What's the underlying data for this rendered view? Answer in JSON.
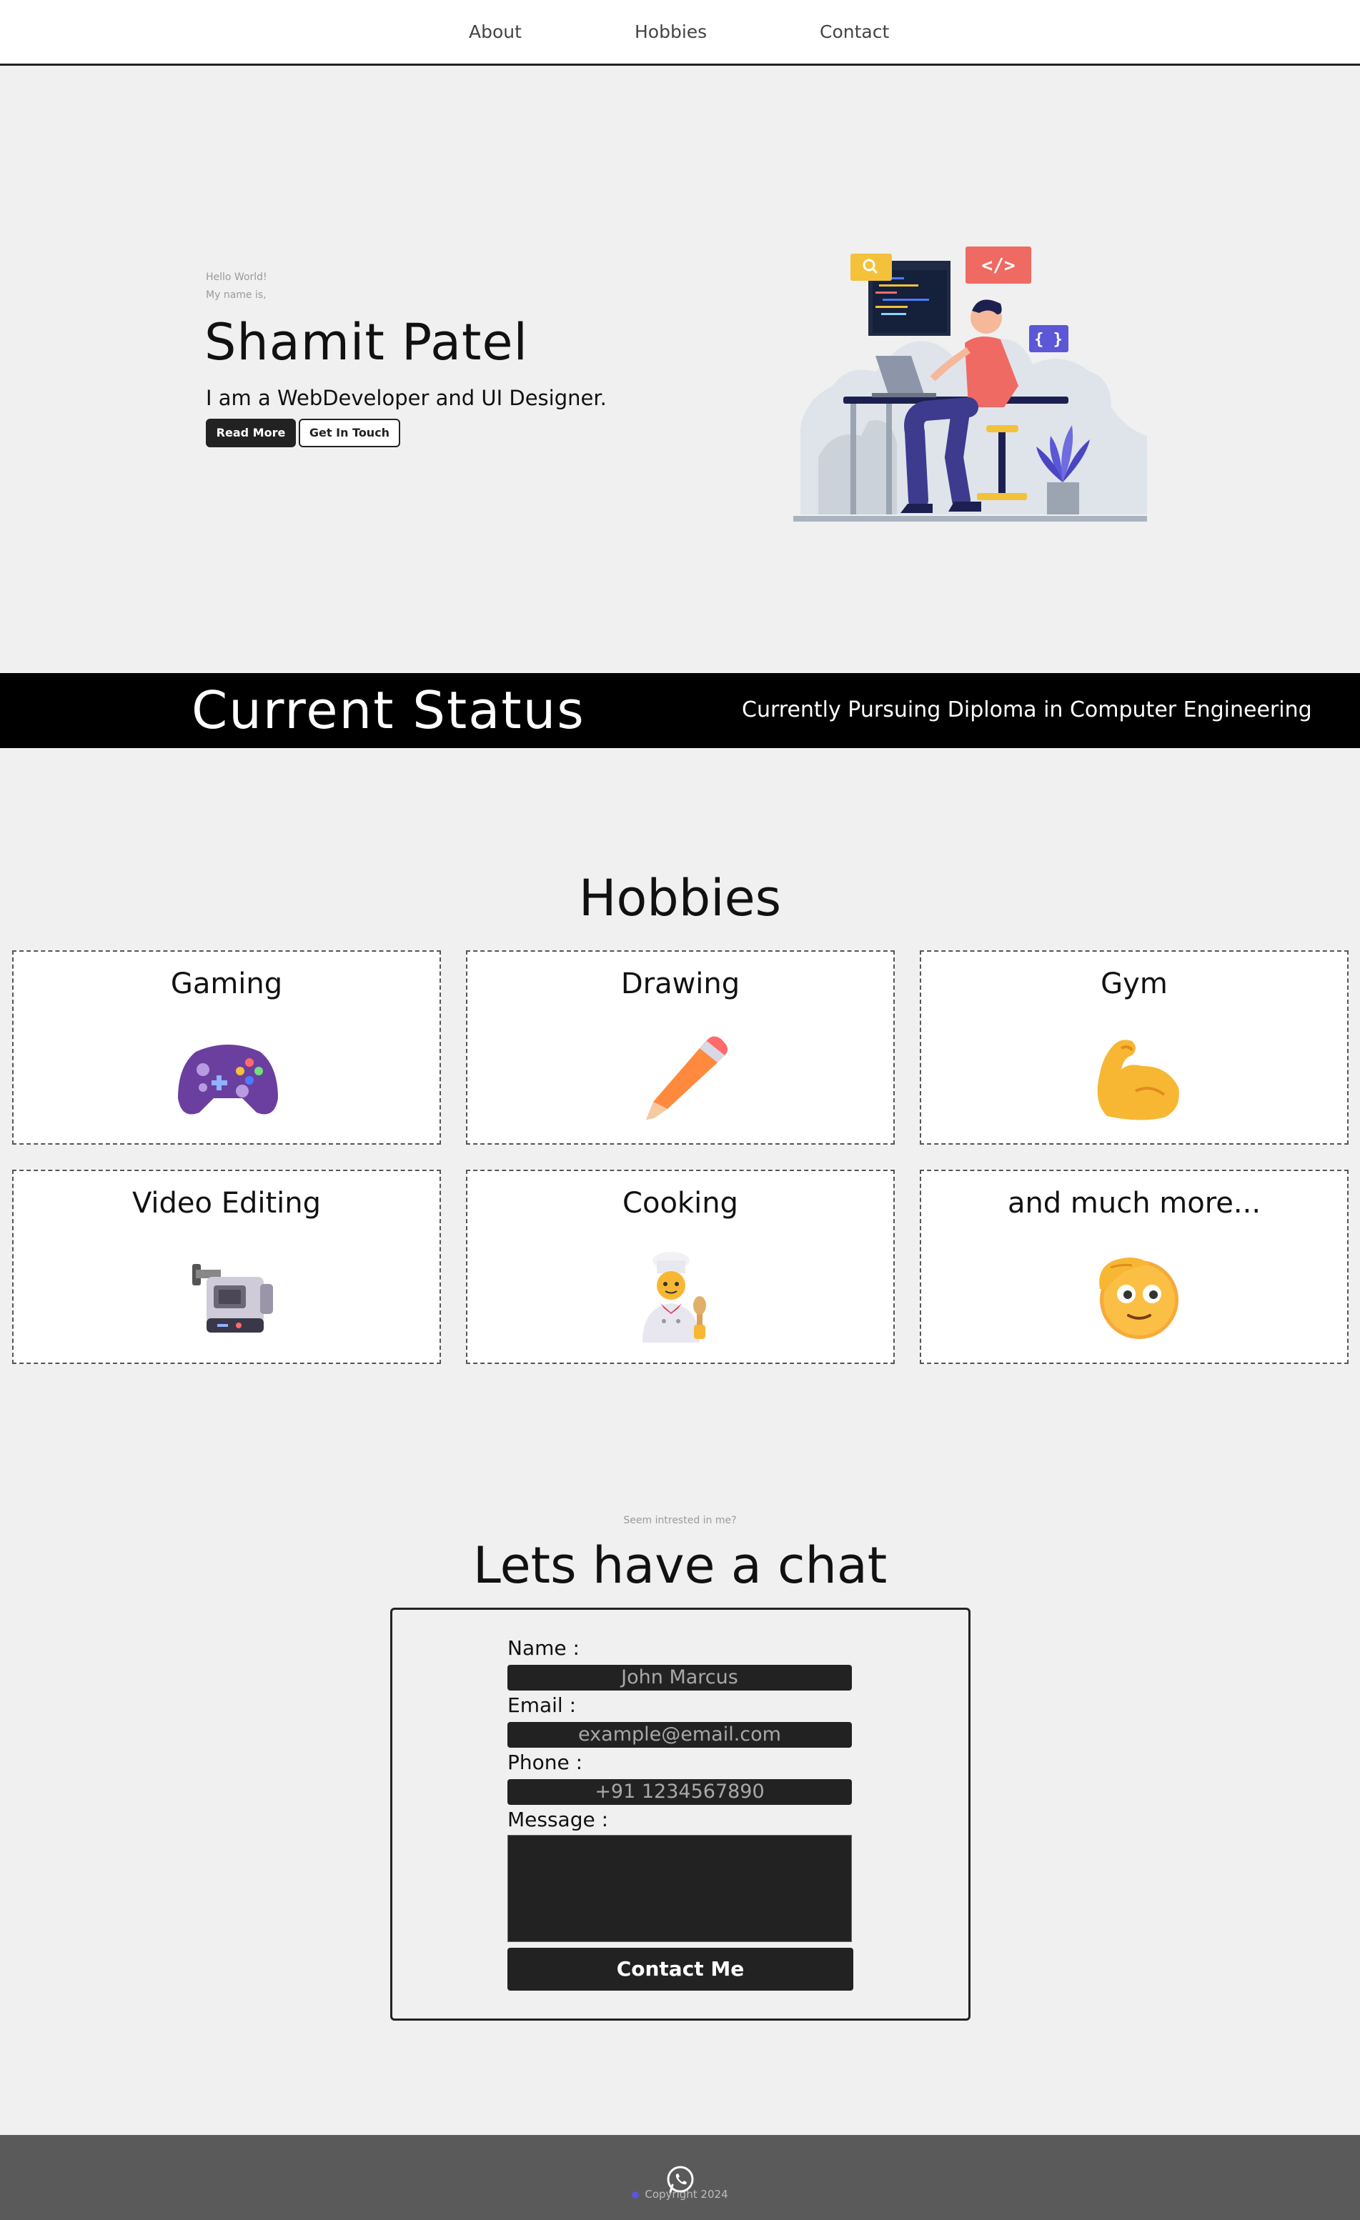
{
  "nav": {
    "items": [
      {
        "label": "About"
      },
      {
        "label": "Hobbies"
      },
      {
        "label": "Contact"
      }
    ]
  },
  "hero": {
    "greeting": "Hello World!",
    "intro": "My name is,",
    "name": "Shamit Patel",
    "tagline": "I am a WebDeveloper and UI Designer.",
    "read_more_label": "Read More",
    "get_in_touch_label": "Get In Touch",
    "illustration": "developer-at-desk-illustration"
  },
  "status": {
    "title": "Current Status",
    "text": "Currently Pursuing Diploma in Computer Engineering"
  },
  "hobbies": {
    "title": "Hobbies",
    "items": [
      {
        "label": "Gaming",
        "icon": "game-controller-icon"
      },
      {
        "label": "Drawing",
        "icon": "pencil-icon"
      },
      {
        "label": "Gym",
        "icon": "flexed-biceps-icon"
      },
      {
        "label": "Video Editing",
        "icon": "video-camera-icon"
      },
      {
        "label": "Cooking",
        "icon": "cook-icon"
      },
      {
        "label": "and much more...",
        "icon": "saluting-face-icon"
      }
    ]
  },
  "contact": {
    "subtitle": "Seem intrested in me?",
    "title": "Lets have a chat",
    "name_label": "Name :",
    "name_placeholder": "John Marcus",
    "email_label": "Email :",
    "email_placeholder": "example@email.com",
    "phone_label": "Phone :",
    "phone_placeholder": "+91 1234567890",
    "message_label": "Message :",
    "submit_label": "Contact Me"
  },
  "footer": {
    "icon": "whatsapp-icon",
    "copyright": "Copyright 2024"
  },
  "colors": {
    "background": "#f0f0f0",
    "dark": "#222222",
    "footer": "#5a5a5a"
  }
}
